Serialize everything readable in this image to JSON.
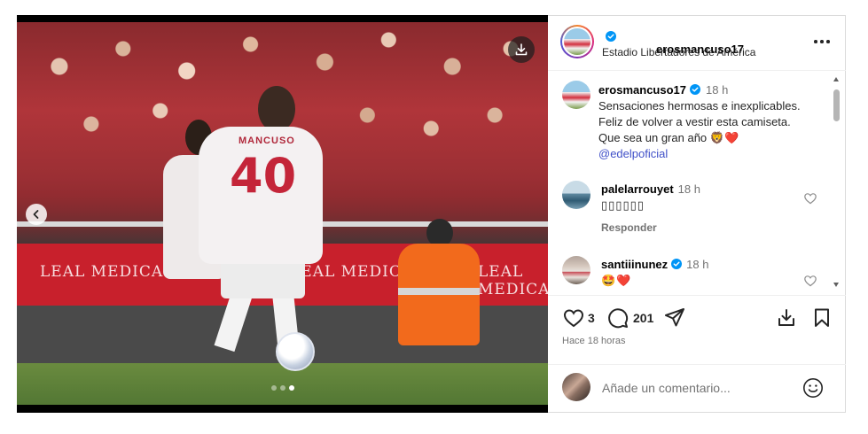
{
  "post": {
    "image_alt": "Jugador con camiseta número 40 conduciendo el balón",
    "jersey_name": "MANCUSO",
    "jersey_number": "40",
    "banner_text": [
      "LEAL MEDICA",
      "LEAL MEDICA",
      "LEAL MEDICA"
    ],
    "carousel": {
      "count": 3,
      "active_index": 2
    }
  },
  "header": {
    "username": "erosmancuso17",
    "verified": true,
    "location": "Estadio Libertadores de América"
  },
  "caption": {
    "username": "erosmancuso17",
    "time": "18 h",
    "text": "Sensaciones hermosas e inexplicables.\nFeliz de volver a vestir esta camiseta.\nQue sea un gran año 🦁❤️",
    "mention": "@edelpoficial"
  },
  "comments": [
    {
      "username": "palelarrouyet",
      "verified": false,
      "time": "18 h",
      "text": "▯▯▯▯▯▯",
      "reply_label": "Responder"
    },
    {
      "username": "santiiinunez",
      "verified": true,
      "time": "18 h",
      "text": "🤩❤️"
    }
  ],
  "actions": {
    "likes": "3",
    "comments": "201",
    "posted": "Hace 18 horas"
  },
  "composer": {
    "placeholder": "Añade un comentario..."
  },
  "colors": {
    "verified_blue": "#0095f6",
    "mention_blue": "#4050c8",
    "like_red": "#ff3040"
  }
}
